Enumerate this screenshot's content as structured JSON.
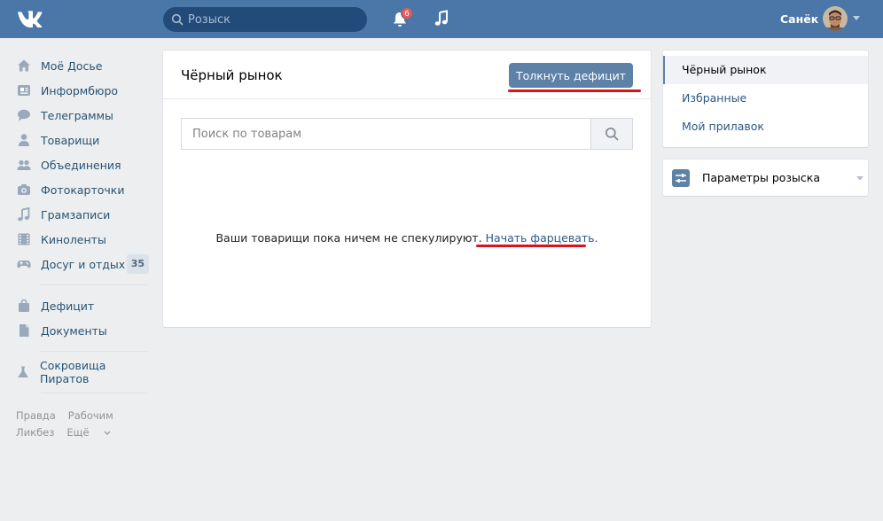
{
  "header": {
    "search_placeholder": "Розыск",
    "notifications_count": "6",
    "user_name": "Санёк",
    "logo": "vk-logo",
    "brand_color": "#4a76a8"
  },
  "leftnav": {
    "items": [
      {
        "label": "Моё Досье",
        "icon": "home-icon"
      },
      {
        "label": "Информбюро",
        "icon": "news-icon"
      },
      {
        "label": "Телеграммы",
        "icon": "messages-icon"
      },
      {
        "label": "Товарищи",
        "icon": "friend-icon"
      },
      {
        "label": "Объединения",
        "icon": "groups-icon"
      },
      {
        "label": "Фотокарточки",
        "icon": "camera-icon"
      },
      {
        "label": "Грамзаписи",
        "icon": "music-note-icon"
      },
      {
        "label": "Киноленты",
        "icon": "film-icon"
      },
      {
        "label": "Досуг и отдых",
        "icon": "gamepad-icon",
        "count": "35"
      }
    ],
    "items2": [
      {
        "label": "Дефицит",
        "icon": "bag-icon"
      },
      {
        "label": "Документы",
        "icon": "document-icon"
      }
    ],
    "items3": [
      {
        "label": "Сокровища Пиратов",
        "icon": "flask-icon"
      }
    ],
    "footer": {
      "link1": "Правда",
      "link2": "Рабочим",
      "link3": "Ликбез",
      "link4": "Ещё"
    }
  },
  "main": {
    "title": "Чёрный рынок",
    "primary_button": "Толкнуть дефицит",
    "search_placeholder": "Поиск по товарам",
    "empty_text": "Ваши товарищи пока ничем не спекулируют.",
    "empty_link": "Начать фарцевать."
  },
  "rightmenu": {
    "items": [
      "Чёрный рынок",
      "Избранные",
      "Мой прилавок"
    ],
    "filter_label": "Параметры розыска"
  },
  "colors": {
    "accent": "#5e81a8",
    "link": "#2a5885",
    "annotation_red": "#d8141e",
    "badge": "#e4585b"
  }
}
